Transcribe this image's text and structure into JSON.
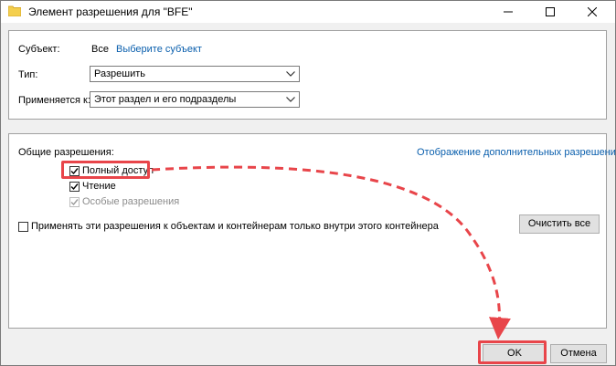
{
  "window": {
    "title": "Элемент разрешения для \"BFE\""
  },
  "principal": {
    "label": "Субъект:",
    "value": "Все",
    "select_link": "Выберите субъект"
  },
  "type": {
    "label": "Тип:",
    "value": "Разрешить"
  },
  "applies_to": {
    "label": "Применяется к:",
    "value": "Этот раздел и его подразделы"
  },
  "permissions": {
    "heading": "Общие разрешения:",
    "advanced_link": "Отображение дополнительных разрешений",
    "items": [
      {
        "label": "Полный доступ",
        "checked": true,
        "enabled": true
      },
      {
        "label": "Чтение",
        "checked": true,
        "enabled": true
      },
      {
        "label": "Особые разрешения",
        "checked": true,
        "enabled": false
      }
    ],
    "apply_inside_label": "Применять эти разрешения к объектам и контейнерам только внутри этого контейнера",
    "clear_all_label": "Очистить все"
  },
  "footer": {
    "ok_label": "OK",
    "cancel_label": "Отмена"
  },
  "colors": {
    "annotation": "#e8454a",
    "link": "#0a5fad",
    "folder": "#f4cf4d"
  }
}
